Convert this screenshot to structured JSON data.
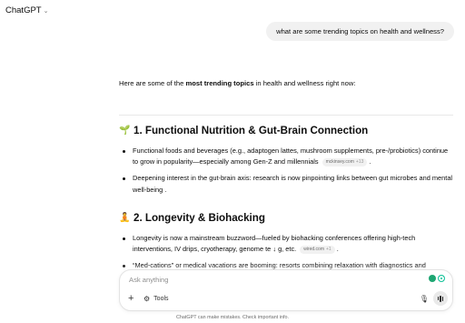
{
  "header": {
    "model_label": "ChatGPT",
    "chevron_icon": "chevron-down-icon"
  },
  "user_message": "what are some trending topics on health and wellness?",
  "assistant": {
    "intro_prefix": "Here are some of the ",
    "intro_bold": "most trending topics",
    "intro_suffix": " in health and wellness right now:",
    "sections": [
      {
        "emoji": "🌱",
        "title": "1. Functional Nutrition & Gut-Brain Connection",
        "bullets": [
          {
            "text": "Functional foods and beverages (e.g., adaptogen lattes, mushroom supplements, pre-/probiotics) continue to grow in popularity—especially among Gen-Z and millennials",
            "chip": "mckinsey.com",
            "chip_count": "+13",
            "tail": " ."
          },
          {
            "text": "Deepening interest in the gut-brain axis: research is now pinpointing links between gut microbes and mental well-being .",
            "chip": "",
            "chip_count": "",
            "tail": ""
          }
        ]
      },
      {
        "emoji": "🧘",
        "title": "2. Longevity & Biohacking",
        "bullets": [
          {
            "text": "Longevity is now a mainstream buzzword—fueled by biohacking conferences offering high-tech interventions, IV drips, cryotherapy, genome te ↓ g, etc.",
            "chip": "wired.com",
            "chip_count": "+1",
            "tail": " ."
          },
          {
            "text": "“Med-cations” or medical vacations are booming: resorts combining relaxation with diagnostics and",
            "chip": "",
            "chip_count": "",
            "tail": ""
          }
        ]
      }
    ]
  },
  "composer": {
    "placeholder": "Ask anything",
    "tools_label": "Tools",
    "plus_icon": "plus-icon",
    "tools_icon": "sliders-icon",
    "mic_icon": "mic-icon",
    "voice_icon": "voice-mode-icon"
  },
  "disclaimer": "ChatGPT can make mistakes. Check important info."
}
